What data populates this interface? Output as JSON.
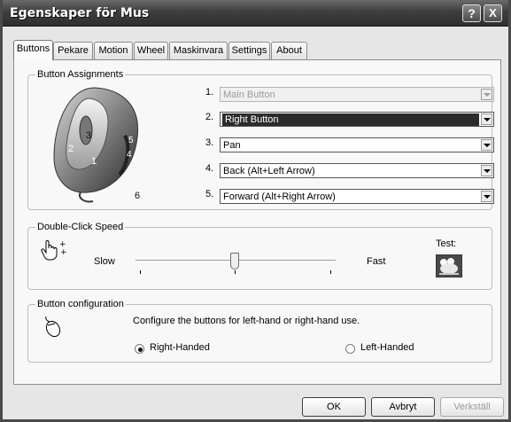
{
  "window": {
    "title": "Egenskaper för Mus",
    "help_glyph": "?",
    "close_glyph": "X"
  },
  "tabs": [
    {
      "label": "Buttons",
      "active": true
    },
    {
      "label": "Pekare",
      "active": false
    },
    {
      "label": "Motion",
      "active": false
    },
    {
      "label": "Wheel",
      "active": false
    },
    {
      "label": "Maskinvara",
      "active": false
    },
    {
      "label": "Settings",
      "active": false
    },
    {
      "label": "About",
      "active": false
    }
  ],
  "button_assignments": {
    "legend": "Button Assignments",
    "mouse_labels": {
      "b1": "1",
      "b2": "2",
      "b3": "3",
      "b4": "4",
      "b5": "5",
      "b6": "6"
    },
    "rows": [
      {
        "num": "1.",
        "value": "Main Button",
        "state": "disabled"
      },
      {
        "num": "2.",
        "value": "Right Button",
        "state": "selected"
      },
      {
        "num": "3.",
        "value": "Pan",
        "state": "normal"
      },
      {
        "num": "4.",
        "value": "Back (Alt+Left Arrow)",
        "state": "normal"
      },
      {
        "num": "5.",
        "value": "Forward (Alt+Right Arrow)",
        "state": "normal"
      }
    ]
  },
  "double_click": {
    "legend": "Double-Click Speed",
    "slow_label": "Slow",
    "fast_label": "Fast",
    "test_label": "Test:",
    "slider_position": 0.5
  },
  "button_config": {
    "legend": "Button configuration",
    "description": "Configure the buttons for left-hand or right-hand use.",
    "right_label": "Right-Handed",
    "left_label": "Left-Handed",
    "selected": "right"
  },
  "footer": {
    "ok_label": "OK",
    "cancel_label": "Avbryt",
    "apply_label": "Verkställ"
  }
}
